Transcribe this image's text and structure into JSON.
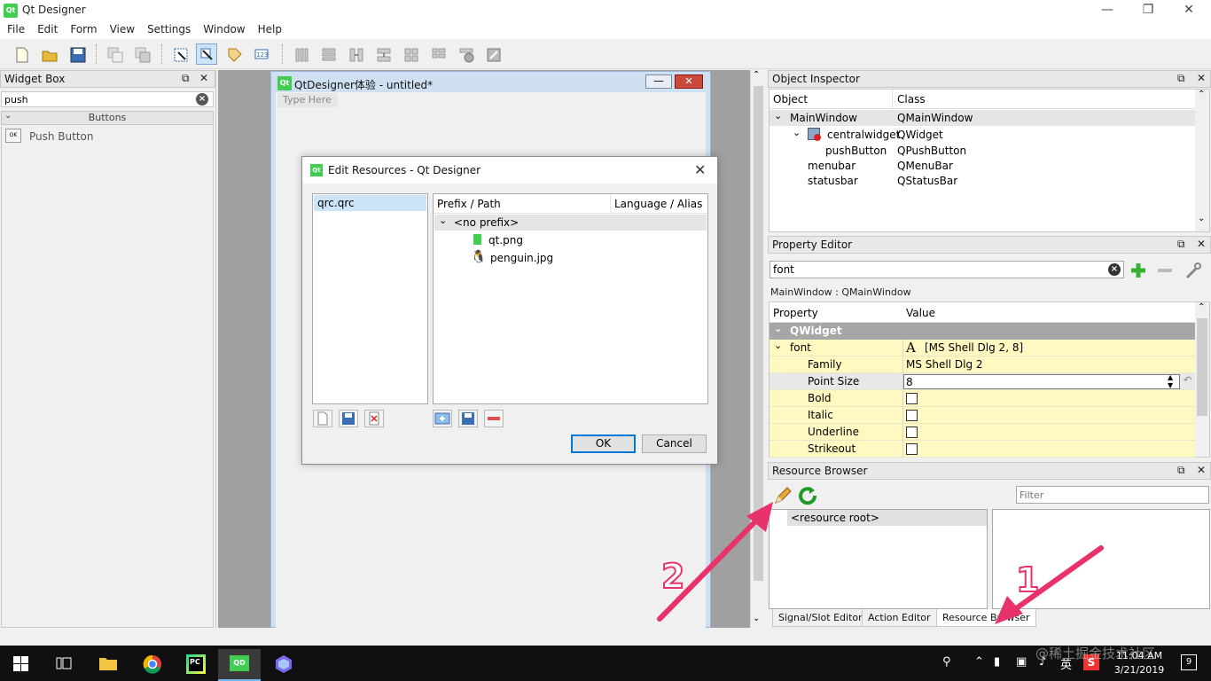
{
  "window": {
    "title": "Qt Designer",
    "icon_text": "Qt"
  },
  "menu": [
    "File",
    "Edit",
    "Form",
    "View",
    "Settings",
    "Window",
    "Help"
  ],
  "widget_box": {
    "title": "Widget Box",
    "filter_value": "push",
    "category": "Buttons",
    "item_icon_text": "OK",
    "item_label": "Push Button"
  },
  "form": {
    "title": "QtDesigner体验 - untitled*",
    "icon_text": "Qt",
    "menu_placeholder": "Type Here"
  },
  "dialog": {
    "title": "Edit Resources - Qt Designer",
    "qrc_file": "qrc.qrc",
    "col_prefix": "Prefix / Path",
    "col_language": "Language / Alias",
    "prefix": "<no prefix>",
    "files": [
      "qt.png",
      "penguin.jpg"
    ],
    "ok_label": "OK",
    "cancel_label": "Cancel"
  },
  "object_inspector": {
    "title": "Object Inspector",
    "col_object": "Object",
    "col_class": "Class",
    "rows": [
      {
        "object": "MainWindow",
        "class": "QMainWindow"
      },
      {
        "object": "centralwidget",
        "class": "QWidget"
      },
      {
        "object": "pushButton",
        "class": "QPushButton"
      },
      {
        "object": "menubar",
        "class": "QMenuBar"
      },
      {
        "object": "statusbar",
        "class": "QStatusBar"
      }
    ]
  },
  "property_editor": {
    "title": "Property Editor",
    "filter_value": "font",
    "class_label": "MainWindow : QMainWindow",
    "col_property": "Property",
    "col_value": "Value",
    "group": "QWidget",
    "font_prop": "font",
    "font_icon": "A",
    "font_value": "[MS Shell Dlg 2, 8]",
    "family_label": "Family",
    "family_value": "MS Shell Dlg 2",
    "pointsize_label": "Point Size",
    "pointsize_value": "8",
    "bold_label": "Bold",
    "italic_label": "Italic",
    "underline_label": "Underline",
    "strikeout_label": "Strikeout"
  },
  "resource_browser": {
    "title": "Resource Browser",
    "filter_placeholder": "Filter",
    "root": "<resource root>"
  },
  "dock_tabs": [
    "Signal/Slot Editor",
    "Action Editor",
    "Resource Browser"
  ],
  "annotations": {
    "label_1": "1",
    "label_2": "2",
    "color": "#e8336a"
  },
  "taskbar": {
    "time": "11:04 AM",
    "date": "3/21/2019",
    "ime": "英",
    "notification_count": "9",
    "watermark": "@稀土掘金技术社区"
  }
}
